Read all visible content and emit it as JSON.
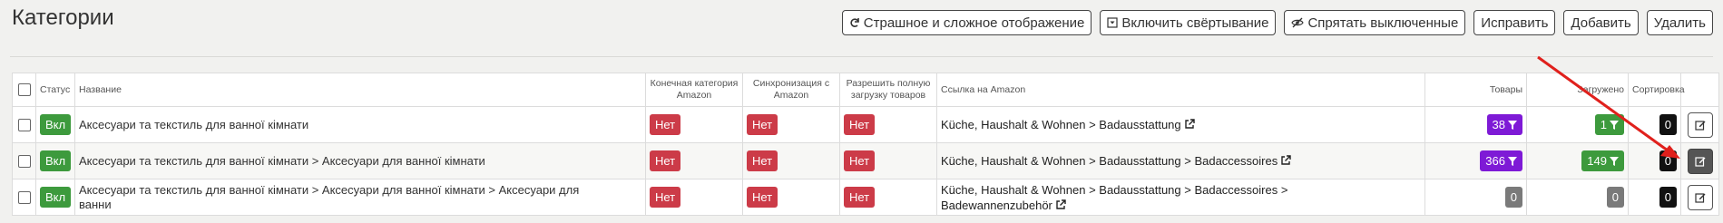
{
  "page": {
    "title": "Категории"
  },
  "toolbar": {
    "buttons": [
      {
        "label": "Страшное и сложное отображение",
        "icon": "refresh-icon"
      },
      {
        "label": "Включить свёртывание",
        "icon": "collapse-icon"
      },
      {
        "label": "Спрятать выключенные",
        "icon": "eye-slash-icon"
      },
      {
        "label": "Исправить"
      },
      {
        "label": "Добавить"
      },
      {
        "label": "Удалить"
      }
    ]
  },
  "table": {
    "headers": {
      "status": "Статус",
      "name": "Название",
      "final_category": "Конечная категория Amazon",
      "sync": "Синхронизация с Amazon",
      "full_load": "Разрешить полную загрузку товаров",
      "link": "Ссылка на Amazon",
      "products": "Товары",
      "loaded": "Загружено",
      "sort": "Сортировка"
    },
    "rows": [
      {
        "status": "Вкл",
        "name": "Аксесуари та текстиль для ванної кімнати",
        "final_category": "Нет",
        "sync": "Нет",
        "full_load": "Нет",
        "link": "Küche, Haushalt & Wohnen > Badausstattung",
        "products": "38",
        "loaded": "1",
        "sort": "0"
      },
      {
        "status": "Вкл",
        "name": "Аксесуари та текстиль для ванної кімнати > Аксесуари для ванної кімнати",
        "final_category": "Нет",
        "sync": "Нет",
        "full_load": "Нет",
        "link": "Küche, Haushalt & Wohnen > Badausstattung > Badaccessoires",
        "products": "366",
        "loaded": "149",
        "sort": "0"
      },
      {
        "status": "Вкл",
        "name": "Аксесуари та текстиль для ванної кімнати > Аксесуари для ванної кімнати > Аксесуари для ванни",
        "final_category": "Нет",
        "sync": "Нет",
        "full_load": "Нет",
        "link": "Küche, Haushalt & Wohnen > Badausstattung > Badaccessoires > Badewannenzubehör",
        "products": "0",
        "loaded": "0",
        "sort": "0"
      }
    ]
  },
  "colors": {
    "status_on": "#3d9a3d",
    "no_badge": "#cc3b48",
    "products_badge": "#7e1ad6",
    "loaded_badge": "#3d9a3d",
    "zero_badge": "#7a7a7a",
    "sort_badge": "#111111",
    "annotation_arrow": "#e0201c"
  }
}
